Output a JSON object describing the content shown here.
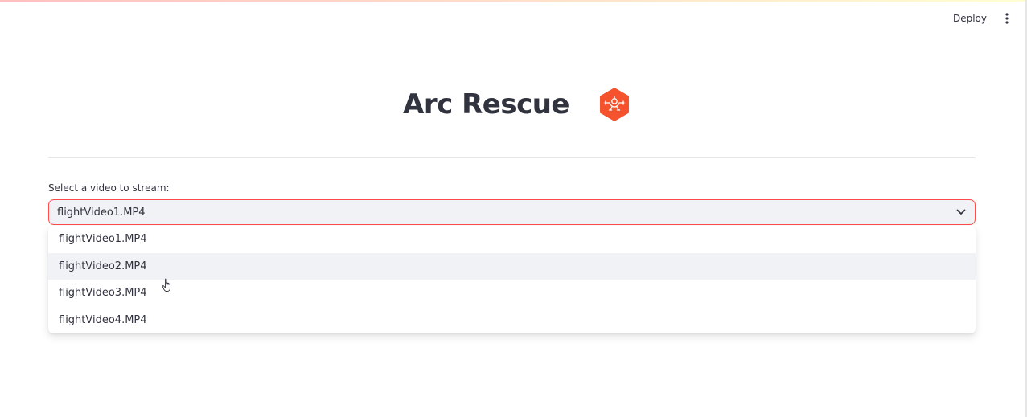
{
  "header": {
    "deploy_label": "Deploy",
    "menu_icon": "vertical-dots-icon"
  },
  "main": {
    "title": "Arc Rescue",
    "logo_icon": "drone-hexagon-logo",
    "select": {
      "label": "Select a video to stream:",
      "value": "flightVideo1.MP4",
      "options": [
        "flightVideo1.MP4",
        "flightVideo2.MP4",
        "flightVideo3.MP4",
        "flightVideo4.MP4"
      ],
      "hovered_option": "flightVideo2.MP4"
    }
  },
  "colors": {
    "accent": "#ff4b4b",
    "logo": "#f5532d",
    "text": "#31333f",
    "select_bg": "#f0f2f6"
  }
}
